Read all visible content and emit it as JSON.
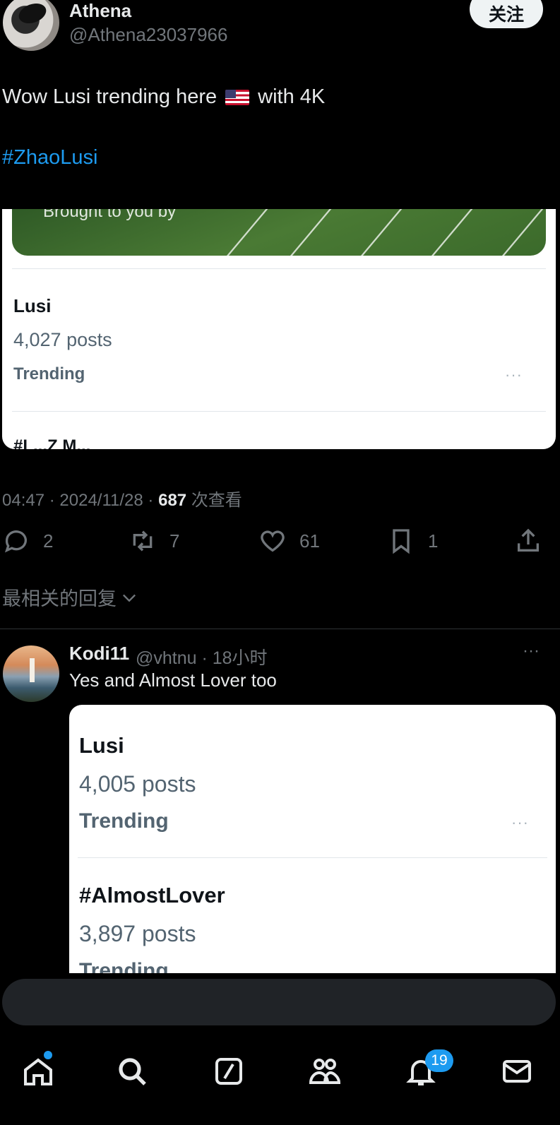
{
  "tweet": {
    "author_name": "Athena",
    "author_handle": "@Athena23037966",
    "follow_label": "关注",
    "text_before_flag": "Wow Lusi trending here",
    "flag_icon": "us-flag-icon",
    "text_after_flag": "with 4K",
    "hashtag": "#ZhaoLusi",
    "media_banner_text": "Brought to you by",
    "card_trend": {
      "name": "Lusi",
      "posts": "4,027 posts",
      "label": "Trending",
      "more": "···"
    },
    "card_cut_text": "#L...Z M...",
    "time": "04:47",
    "date": "2024/11/28",
    "views_count": "687",
    "views_label": "次查看",
    "actions": {
      "reply_count": "2",
      "repost_count": "7",
      "like_count": "61",
      "bookmark_count": "1"
    }
  },
  "replies_sort_label": "最相关的回复",
  "reply": {
    "author_name": "Kodi11",
    "author_handle": "@vhtnu · 18小时",
    "more": "···",
    "text": "Yes and Almost Lover too",
    "card_trends": [
      {
        "name": "Lusi",
        "posts": "4,005 posts",
        "label": "Trending",
        "more": "···"
      },
      {
        "name": "#AlmostLover",
        "posts": "3,897 posts",
        "label": "Trending"
      }
    ]
  },
  "bottom_nav": {
    "items": [
      "home-icon",
      "search-icon",
      "grok-icon",
      "communities-icon",
      "notifications-icon",
      "messages-icon"
    ],
    "notifications_badge": "19"
  },
  "colors": {
    "background": "#000000",
    "accent": "#1d9bf0",
    "text_primary": "#e7e9ea",
    "text_secondary": "#71767b"
  }
}
